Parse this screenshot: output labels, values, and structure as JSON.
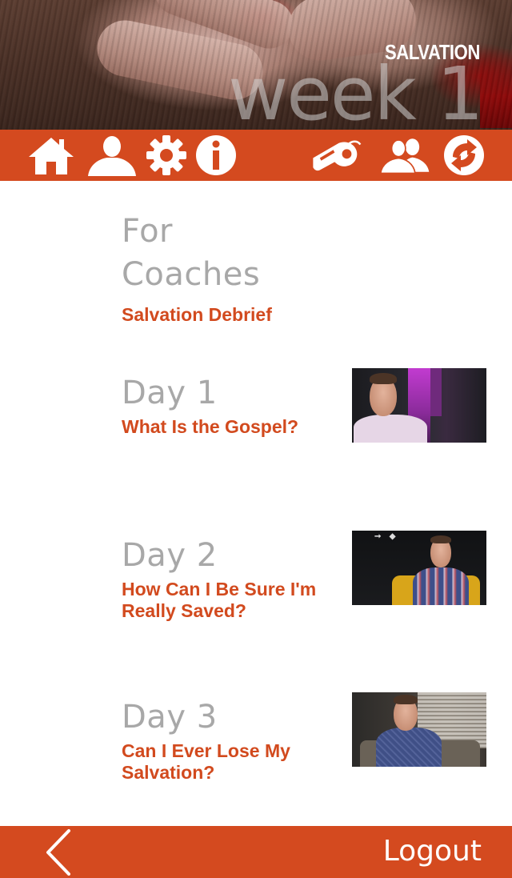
{
  "header": {
    "series_title": "SALVATION",
    "week_label": "week 1"
  },
  "toolbar": {
    "left_icons": [
      "home-icon",
      "profile-icon",
      "gear-icon",
      "info-icon"
    ],
    "right_icons": [
      "whistle-icon",
      "group-icon",
      "circle-arrow-icon"
    ],
    "colors": {
      "bar": "#d44a1f",
      "icon": "#ffffff"
    }
  },
  "content": {
    "coaches": {
      "heading": "For Coaches",
      "subtitle": "Salvation Debrief"
    },
    "days": [
      {
        "heading": "Day 1",
        "subtitle": "What Is the Gospel?"
      },
      {
        "heading": "Day 2",
        "subtitle": "How Can I Be Sure I'm Really Saved?"
      },
      {
        "heading": "Day 3",
        "subtitle": "Can I Ever Lose My Salvation?"
      }
    ]
  },
  "footer": {
    "back_icon": "chevron-left-icon",
    "logout_label": "Logout"
  },
  "colors": {
    "accent": "#d44a1f",
    "heading_gray": "#a8a8a8",
    "subtitle_orange": "#d24a1e"
  }
}
